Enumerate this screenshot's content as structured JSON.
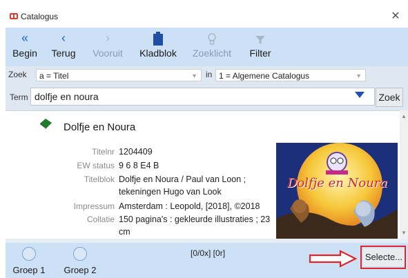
{
  "window": {
    "title": "Catalogus"
  },
  "toolbar": {
    "begin": "Begin",
    "terug": "Terug",
    "vooruit": "Vooruit",
    "kladblok": "Kladblok",
    "zoeklicht": "Zoeklicht",
    "filter": "Filter"
  },
  "search": {
    "zoek_label": "Zoek",
    "zoek_value": "a = Titel",
    "in_label": "in",
    "in_value": "1 = Algemene Catalogus",
    "term_label": "Term",
    "term_value": "dolfje en noura",
    "zoek_button": "Zoek"
  },
  "result": {
    "title": "Dolfje en Noura",
    "fields": [
      {
        "label": "Titelnr",
        "value": "1204409"
      },
      {
        "label": "EW status",
        "value": "9 6 8 E4 B"
      },
      {
        "label": "Titelblok",
        "value": "Dolfje en Noura / Paul van Loon ; tekeningen Hugo van Look"
      },
      {
        "label": "Impressum",
        "value": "Amsterdam : Leopold, [2018], ©2018"
      },
      {
        "label": "Collatie",
        "value": "150 pagina's : gekleurde illustraties ; 23 cm"
      }
    ],
    "cover_text": "Dolfje en Noura"
  },
  "bottom": {
    "groep1": "Groep 1",
    "groep2": "Groep 2",
    "counter": "[0/0x] [0r]",
    "select_button": "Selecte..."
  },
  "colors": {
    "toolbar_bg": "#cde1f6",
    "accent": "#1f66c9",
    "annotation": "#e2232a"
  }
}
